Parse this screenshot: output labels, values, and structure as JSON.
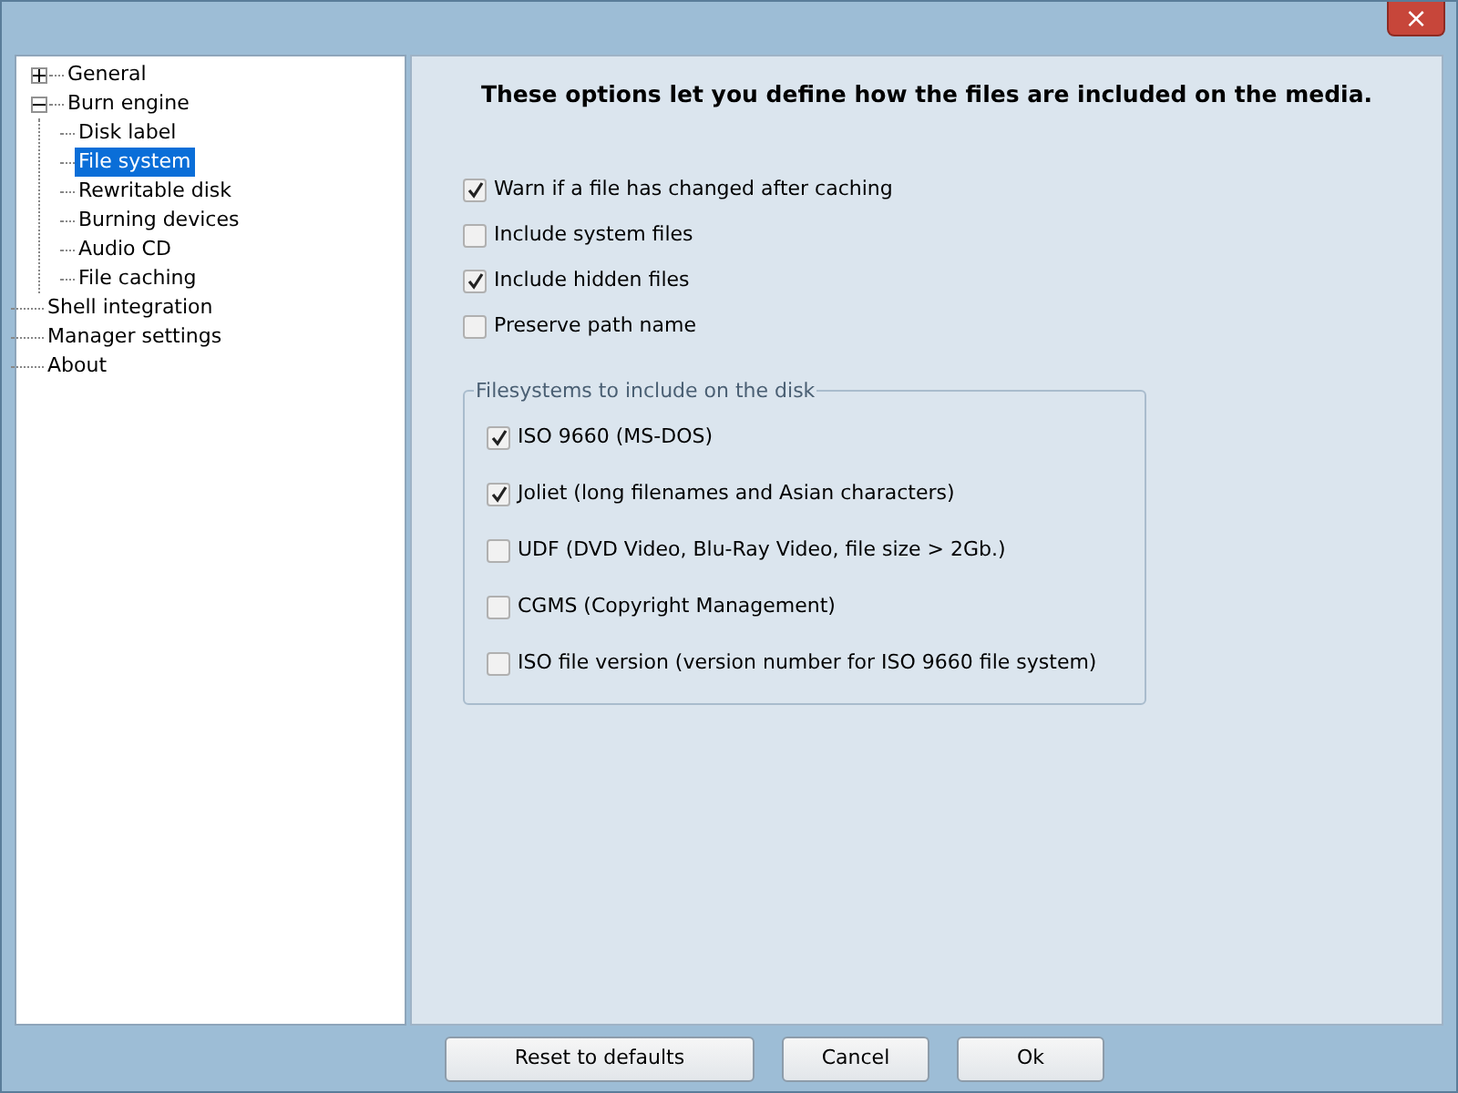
{
  "window": {
    "close_button": "×"
  },
  "tree": [
    {
      "label": "General",
      "expanded": false,
      "selected": false
    },
    {
      "label": "Burn engine",
      "expanded": true,
      "selected": false,
      "children": [
        {
          "label": "Disk label",
          "selected": false
        },
        {
          "label": "File system",
          "selected": true
        },
        {
          "label": "Rewritable disk",
          "selected": false
        },
        {
          "label": "Burning devices",
          "selected": false
        },
        {
          "label": "Audio CD",
          "selected": false
        },
        {
          "label": "File caching",
          "selected": false
        }
      ]
    },
    {
      "label": "Shell integration",
      "selected": false
    },
    {
      "label": "Manager settings",
      "selected": false
    },
    {
      "label": "About",
      "selected": false
    }
  ],
  "heading": "These options let you define how the files are included on the media.",
  "options": [
    {
      "label": "Warn if a file has changed after caching",
      "checked": true
    },
    {
      "label": "Include system files",
      "checked": false
    },
    {
      "label": "Include hidden files",
      "checked": true
    },
    {
      "label": "Preserve path name",
      "checked": false
    }
  ],
  "filesystems": {
    "legend": "Filesystems to include on the disk",
    "options": [
      {
        "label": "ISO 9660 (MS-DOS)",
        "checked": true
      },
      {
        "label": "Joliet (long filenames and Asian characters)",
        "checked": true
      },
      {
        "label": "UDF (DVD Video, Blu-Ray Video, file size > 2Gb.)",
        "checked": false
      },
      {
        "label": "CGMS (Copyright Management)",
        "checked": false
      },
      {
        "label": "ISO file version (version number for ISO 9660 file system)",
        "checked": false
      }
    ]
  },
  "buttons": [
    {
      "label": "Reset to defaults",
      "kind": "wide"
    },
    {
      "label": "Cancel",
      "kind": "normal"
    },
    {
      "label": "Ok",
      "kind": "normal"
    }
  ]
}
